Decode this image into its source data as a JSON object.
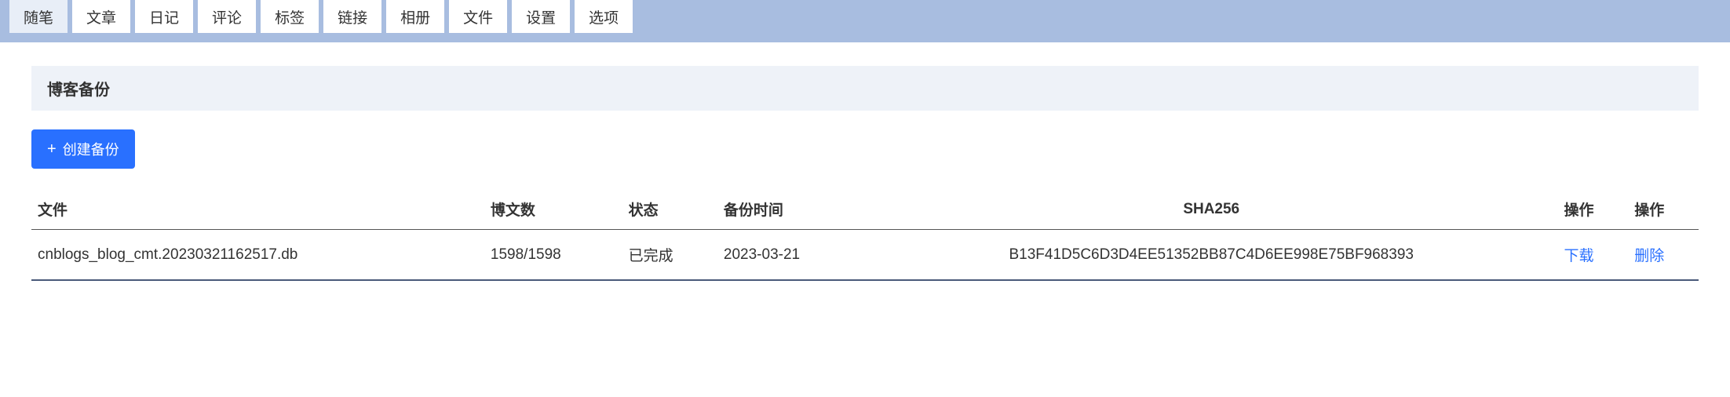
{
  "tabs": [
    {
      "label": "随笔",
      "active": true
    },
    {
      "label": "文章",
      "active": false
    },
    {
      "label": "日记",
      "active": false
    },
    {
      "label": "评论",
      "active": false
    },
    {
      "label": "标签",
      "active": false
    },
    {
      "label": "链接",
      "active": false
    },
    {
      "label": "相册",
      "active": false
    },
    {
      "label": "文件",
      "active": false
    },
    {
      "label": "设置",
      "active": false
    },
    {
      "label": "选项",
      "active": false
    }
  ],
  "section_title": "博客备份",
  "create_button": "创建备份",
  "table": {
    "headers": {
      "file": "文件",
      "post_count": "博文数",
      "status": "状态",
      "backup_time": "备份时间",
      "sha256": "SHA256",
      "action1": "操作",
      "action2": "操作"
    },
    "rows": [
      {
        "file": "cnblogs_blog_cmt.20230321162517.db",
        "post_count": "1598/1598",
        "status": "已完成",
        "backup_time": "2023-03-21",
        "sha256": "B13F41D5C6D3D4EE51352BB87C4D6EE998E75BF968393",
        "download": "下载",
        "delete": "删除"
      }
    ]
  }
}
